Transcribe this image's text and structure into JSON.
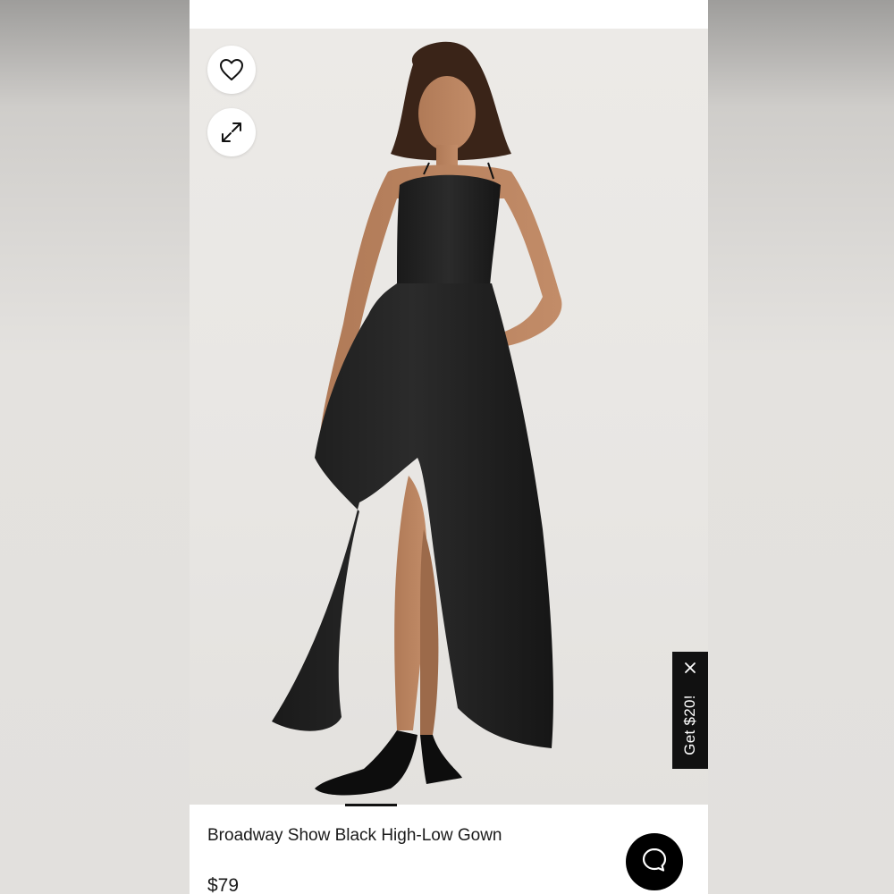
{
  "product": {
    "name": "Broadway Show Black High-Low Gown",
    "price": "$79"
  },
  "promo": {
    "label": "Get $20!"
  },
  "icons": {
    "wishlist": "heart-icon",
    "expand": "expand-arrows-icon",
    "close": "close-icon",
    "chat": "chat-bubble-icon"
  },
  "colors": {
    "accent": "#000000",
    "background": "#ffffff"
  }
}
